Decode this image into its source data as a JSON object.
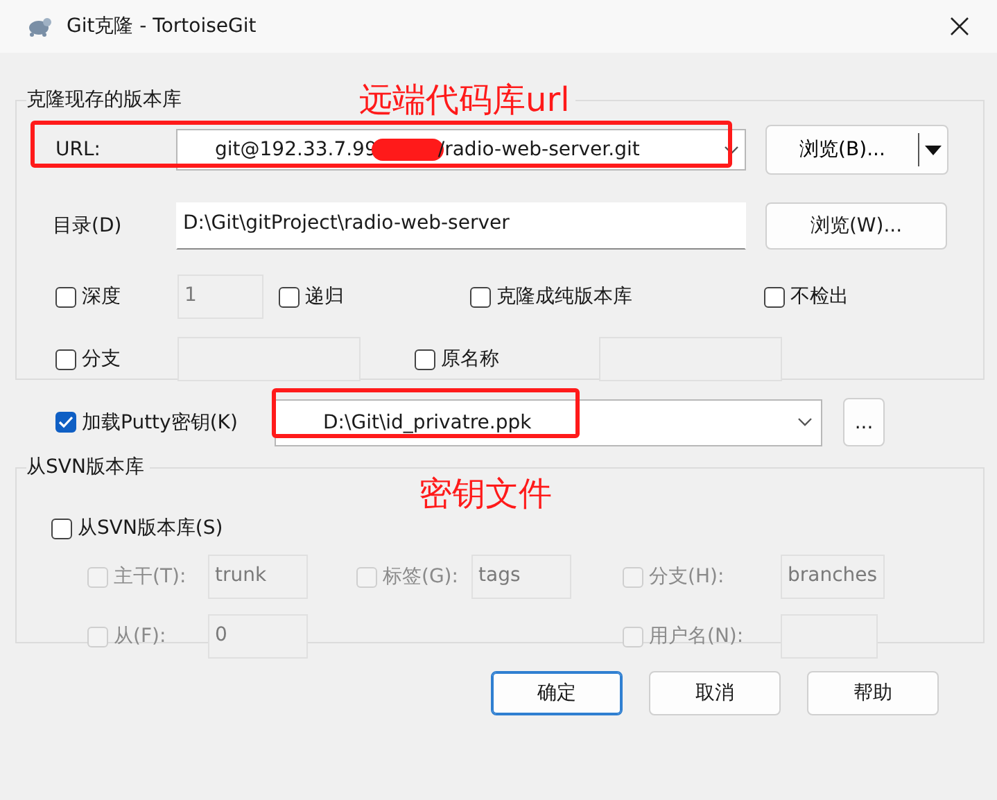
{
  "window": {
    "title": "Git克隆 - TortoiseGit"
  },
  "clone_group": {
    "title": "克隆现存的版本库",
    "annotation": "远端代码库url",
    "url": {
      "label": "URL:",
      "value_start": "git@192.33.7.99",
      "value_end": "/radio-web-server.git",
      "redacted": true,
      "highlighted": true
    },
    "browse_url_button": "浏览(B)...",
    "directory": {
      "label": "目录(D)",
      "value": "D:\\Git\\gitProject\\radio-web-server"
    },
    "browse_dir_button": "浏览(W)...",
    "option_rows": [
      [
        {
          "kind": "check_field",
          "label": "深度",
          "checked": false,
          "value": "1"
        },
        {
          "kind": "check",
          "label": "递归",
          "checked": false
        },
        {
          "kind": "check",
          "label": "克隆成纯版本库",
          "checked": false
        },
        {
          "kind": "check",
          "label": "不检出",
          "checked": false
        }
      ],
      [
        {
          "kind": "check_field",
          "label": "分支",
          "checked": false
        },
        {
          "kind": "check_field",
          "label": "原名称",
          "checked": false
        }
      ]
    ]
  },
  "putty": {
    "label": "加载Putty密钥(K)",
    "checked": true,
    "value": "D:\\Git\\id_privatre.ppk",
    "highlighted": true,
    "button": "..."
  },
  "svn_group": {
    "title": "从SVN版本库",
    "annotation": "密钥文件",
    "enable": {
      "label": "从SVN版本库(S)",
      "checked": false
    },
    "rows": [
      [
        {
          "kind": "check_field",
          "label": "主干(T):",
          "checked": false,
          "disabled": true,
          "value": "trunk"
        },
        {
          "kind": "check_field",
          "label": "标签(G):",
          "checked": false,
          "disabled": true,
          "value": "tags"
        },
        {
          "kind": "check_field",
          "label": "分支(H):",
          "checked": false,
          "disabled": true,
          "value": "branches"
        }
      ],
      [
        {
          "kind": "check_field",
          "label": "从(F):",
          "checked": false,
          "disabled": true,
          "value": "0"
        },
        {
          "kind": "empty"
        },
        {
          "kind": "check_field",
          "label": "用户名(N):",
          "checked": false,
          "disabled": true
        }
      ]
    ]
  },
  "buttons": [
    {
      "label": "确定",
      "default": true
    },
    {
      "label": "取消",
      "default": false
    },
    {
      "label": "帮助",
      "default": false
    }
  ]
}
